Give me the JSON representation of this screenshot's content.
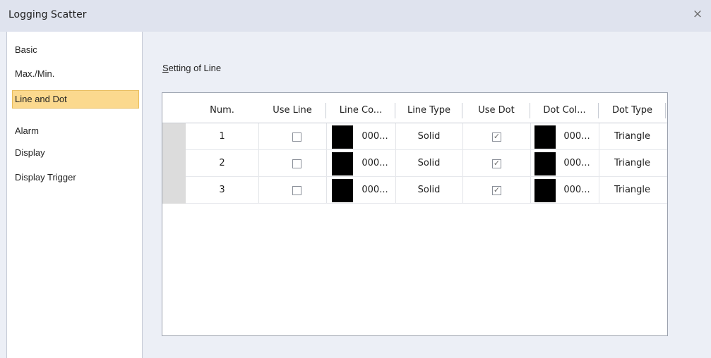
{
  "window": {
    "title": "Logging Scatter",
    "close_label": "×"
  },
  "sidebar": {
    "items": [
      {
        "label": "Basic"
      },
      {
        "label": "Max./Min."
      },
      {
        "label": "Line and Dot",
        "selected": true
      },
      {
        "label": "Alarm"
      },
      {
        "label": "Display"
      },
      {
        "label": "Display Trigger"
      }
    ]
  },
  "main": {
    "section_label_first": "S",
    "section_label_rest": "etting of Line"
  },
  "table": {
    "columns": [
      "Num.",
      "Use Line",
      "Line Co...",
      "Line Type",
      "Use Dot",
      "Dot Col...",
      "Dot Type"
    ],
    "rows": [
      {
        "num": "1",
        "use_line": false,
        "line_color_value": "000...",
        "line_color": "#000000",
        "line_type": "Solid",
        "use_dot": true,
        "dot_color_value": "000...",
        "dot_color": "#000000",
        "dot_type": "Triangle"
      },
      {
        "num": "2",
        "use_line": false,
        "line_color_value": "000...",
        "line_color": "#000000",
        "line_type": "Solid",
        "use_dot": true,
        "dot_color_value": "000...",
        "dot_color": "#000000",
        "dot_type": "Triangle"
      },
      {
        "num": "3",
        "use_line": false,
        "line_color_value": "000...",
        "line_color": "#000000",
        "line_type": "Solid",
        "use_dot": true,
        "dot_color_value": "000...",
        "dot_color": "#000000",
        "dot_type": "Triangle"
      }
    ]
  },
  "colors": {
    "selected_item_bg": "#fbd98e",
    "titlebar_bg": "#dfe3ee"
  }
}
